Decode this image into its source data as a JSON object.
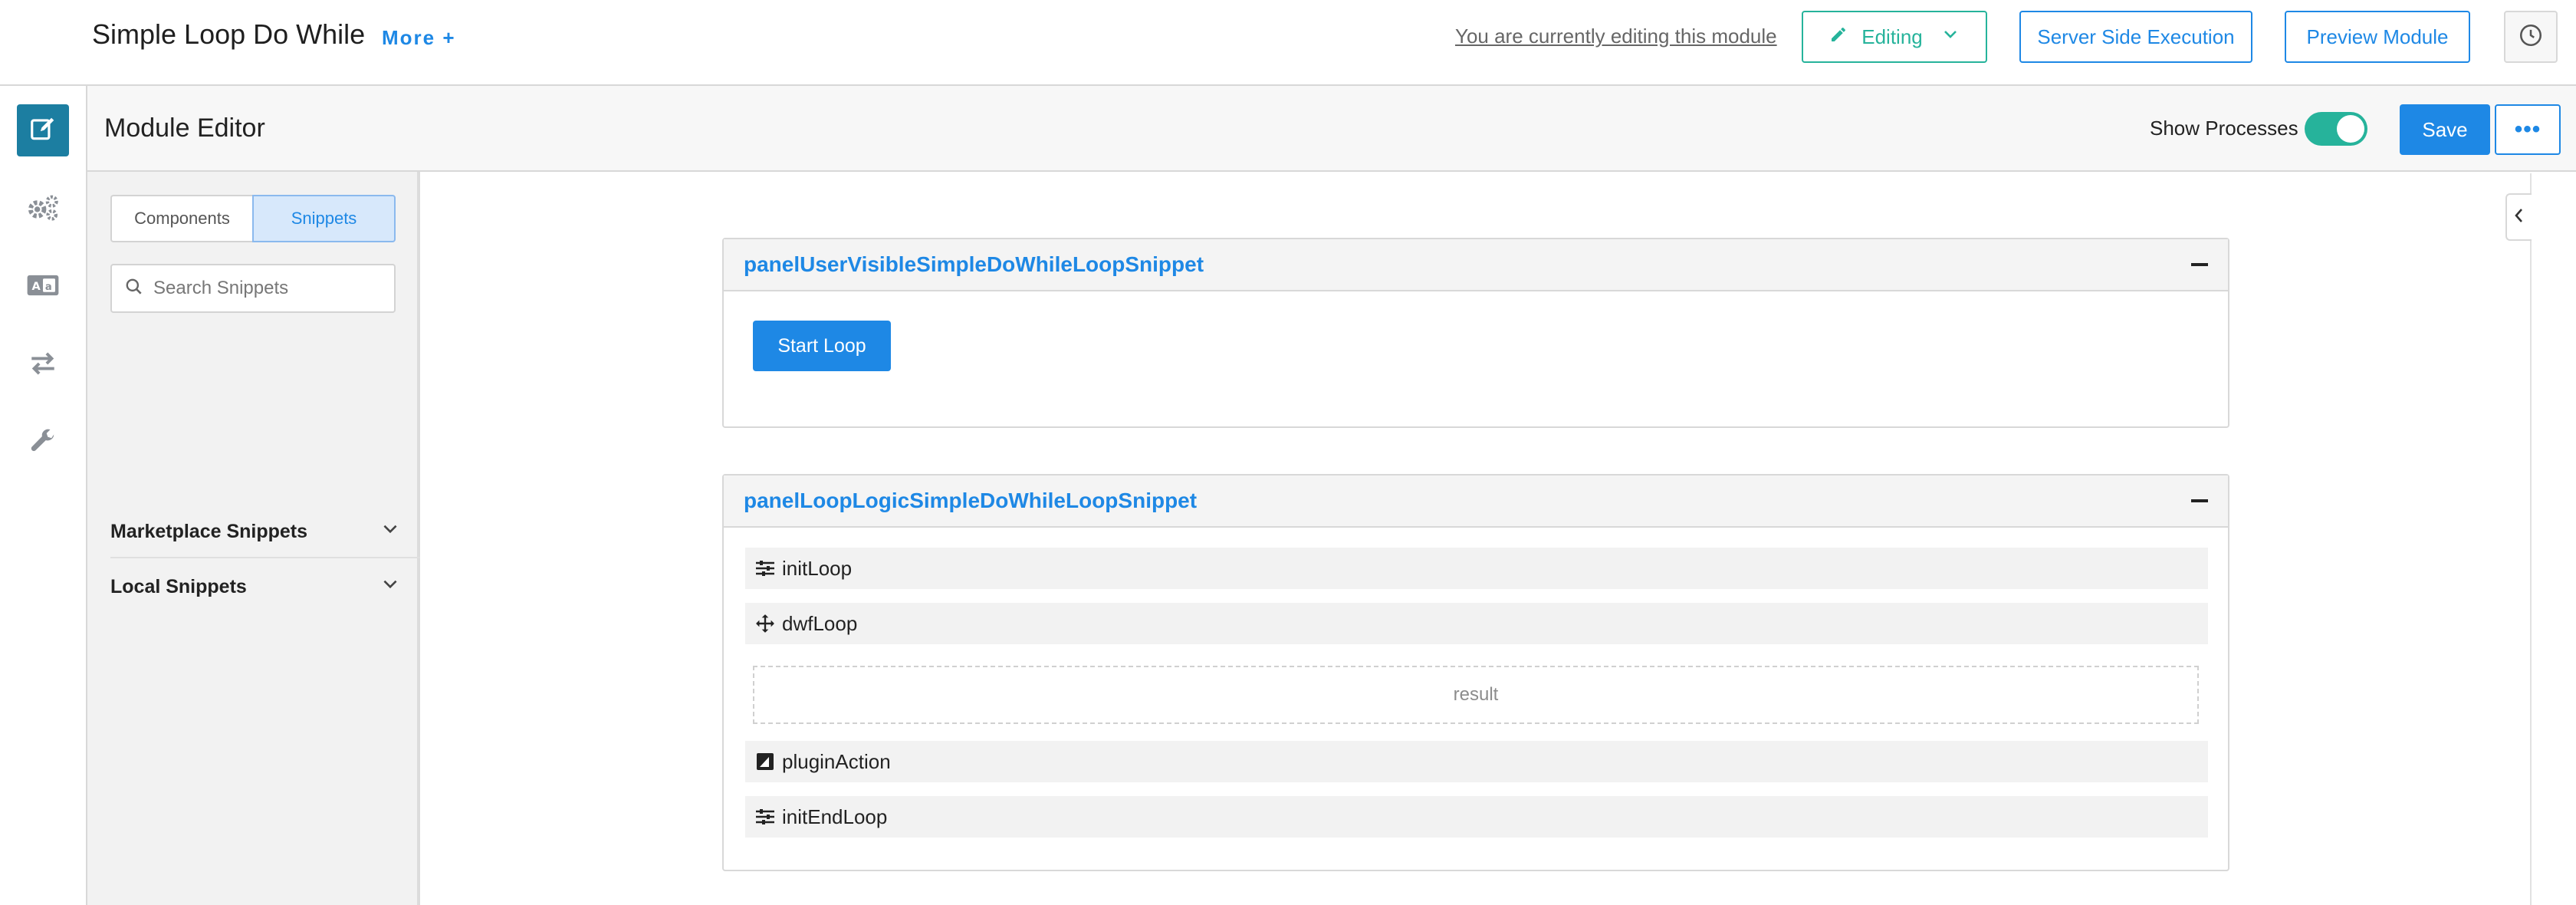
{
  "header": {
    "title": "Simple Loop Do While",
    "more_label": "More +",
    "editing_note": "You are currently editing this module",
    "editing_label": "Editing",
    "server_side_label": "Server Side Execution",
    "preview_label": "Preview Module"
  },
  "editor": {
    "title": "Module Editor",
    "show_processes_label": "Show Processes",
    "show_processes_on": true,
    "save_label": "Save",
    "more_actions_label": "•••"
  },
  "sidebar": {
    "tabs": [
      {
        "label": "Components",
        "active": false
      },
      {
        "label": "Snippets",
        "active": true
      }
    ],
    "search_placeholder": "Search Snippets",
    "sections": [
      {
        "label": "Marketplace Snippets"
      },
      {
        "label": "Local Snippets"
      }
    ]
  },
  "rail": {
    "items": [
      "edit-icon",
      "gears-icon",
      "id-card-icon",
      "transfer-arrows-icon",
      "wrench-icon"
    ],
    "active": "edit-icon"
  },
  "canvas": {
    "panels": [
      {
        "title": "panelUserVisibleSimpleDoWhileLoopSnippet",
        "button_label": "Start Loop"
      },
      {
        "title": "panelLoopLogicSimpleDoWhileLoopSnippet",
        "rows": [
          {
            "label": "initLoop",
            "icon": "sliders-icon"
          },
          {
            "label": "dwfLoop",
            "icon": "move-arrows-icon"
          },
          {
            "label": "pluginAction",
            "icon": "plugin-icon"
          },
          {
            "label": "initEndLoop",
            "icon": "sliders-icon"
          }
        ],
        "dropzone_label": "result"
      }
    ]
  },
  "colors": {
    "primary": "#1e88e5",
    "teal": "#26b39b",
    "rail_active": "#1c7ea1"
  }
}
